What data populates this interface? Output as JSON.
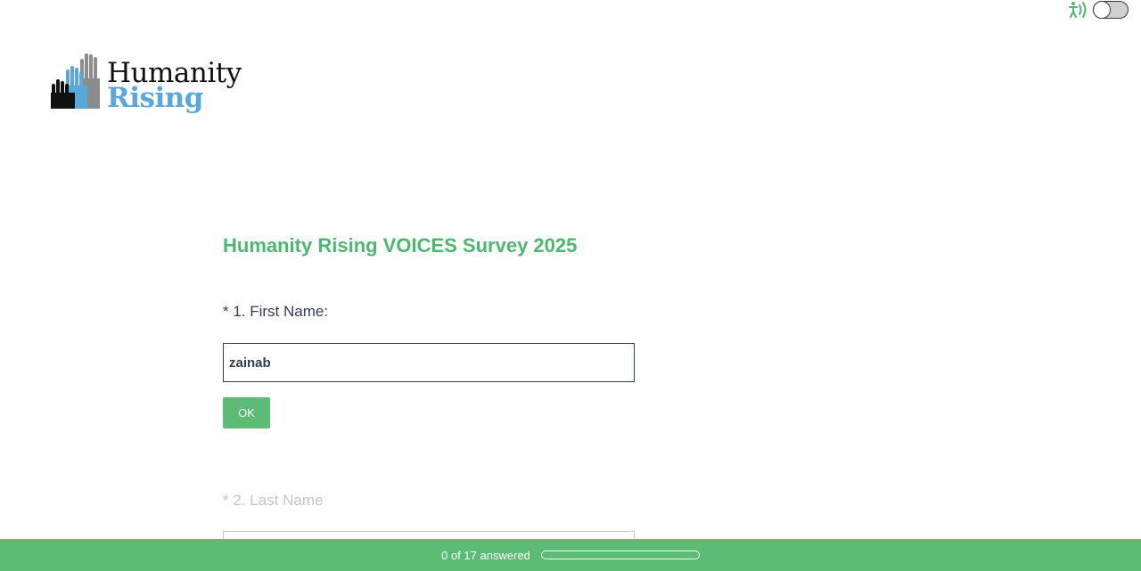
{
  "accessibility": {
    "icon": "accessibility-audio-icon",
    "toggle_state": "off"
  },
  "logo": {
    "line1": "Humanity",
    "line2": "Rising"
  },
  "survey": {
    "title": "Humanity Rising VOICES Survey 2025",
    "questions": [
      {
        "label": "* 1. First Name:",
        "value": "zainab"
      },
      {
        "label": "* 2. Last Name",
        "value": ""
      }
    ],
    "ok_label": "OK"
  },
  "footer": {
    "progress_text": "0 of 17 answered",
    "progress_fraction": 0
  },
  "colors": {
    "accent": "#4cb86e",
    "button": "#5cbb74",
    "logo_blue": "#5aa7db"
  }
}
